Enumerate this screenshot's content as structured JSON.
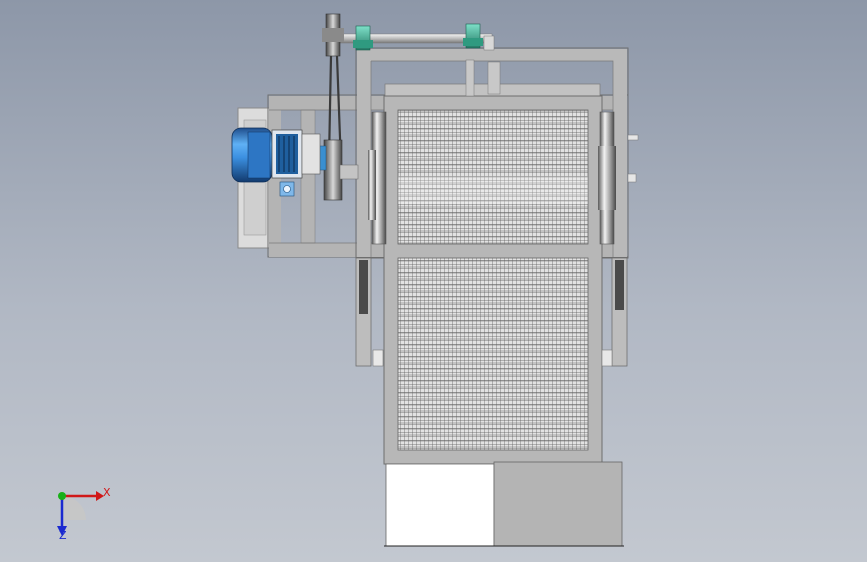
{
  "viewport": {
    "background_top": "#8d97a8",
    "background_bottom": "#c3c8d0"
  },
  "triad": {
    "x_label": "X",
    "z_label": "Z",
    "x_color": "#d01818",
    "y_color": "#18b018",
    "z_color": "#1a2ad0"
  },
  "model": {
    "frame_color": "#b4b4b4",
    "motor_color": "#3b8fe0",
    "bearing_color": "#3fb59a",
    "mesh_color": "#d6d6d6"
  }
}
